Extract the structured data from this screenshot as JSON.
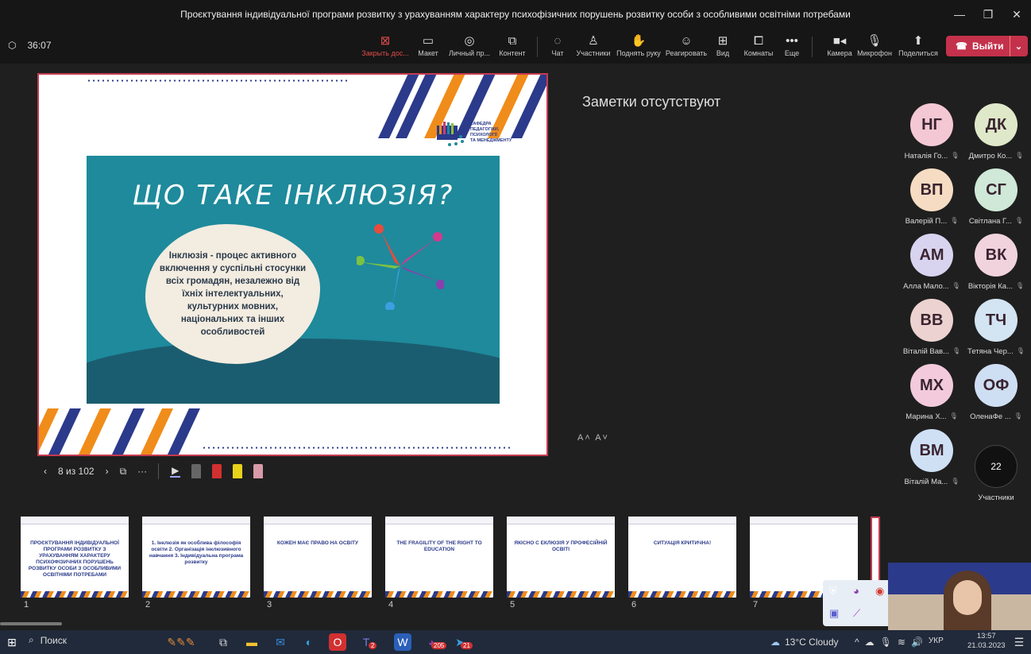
{
  "window": {
    "title": "Проєктування індивідуальної програми розвитку з урахуванням характеру психофізичних порушень розвитку особи з особливими освітніми потребами"
  },
  "meeting": {
    "timer": "36:07",
    "leave_label": "Выйти"
  },
  "toolbar": {
    "stop_share": "Закрыть дос...",
    "layout": "Макет",
    "personal": "Личный пр...",
    "content": "Контент",
    "chat": "Чат",
    "participants": "Участники",
    "raise_hand": "Поднять руку",
    "react": "Реагировать",
    "view": "Вид",
    "rooms": "Комнаты",
    "more": "Еще",
    "camera": "Камера",
    "mic": "Микрофон",
    "share": "Поделиться"
  },
  "slide": {
    "dept_line1": "КАФЕДРА",
    "dept_line2": "ПЕДАГОГІКИ,",
    "dept_line3": "ПСИХОЛОГІЇ",
    "dept_line4": "ТА МЕНЕДЖМЕНТУ",
    "heading": "ЩО ТАКЕ ІНКЛЮЗІЯ?",
    "definition": "Інклюзія - процес активного включення у суспільні стосунки всіх громадян, незалежно від їхніх інтелектуальних, культурних мовних, національних та інших особливостей"
  },
  "notes": {
    "empty_text": "Заметки отсутствуют",
    "font_controls": "A˄ A˅"
  },
  "slide_nav": {
    "counter": "8 из 102"
  },
  "participants": [
    {
      "initials": "НГ",
      "name": "Наталія Го...",
      "color": "#f4c7d4"
    },
    {
      "initials": "ДК",
      "name": "Дмитро Ко...",
      "color": "#dfe8c9"
    },
    {
      "initials": "ВП",
      "name": "Валерій П...",
      "color": "#f6dcc3"
    },
    {
      "initials": "СГ",
      "name": "Світлана Г...",
      "color": "#cfe8d8"
    },
    {
      "initials": "АМ",
      "name": "Алла Мало...",
      "color": "#d8d3ee"
    },
    {
      "initials": "ВК",
      "name": "Вікторія Ка...",
      "color": "#f1d3de"
    },
    {
      "initials": "ВВ",
      "name": "Віталій Вав...",
      "color": "#ecd2d0"
    },
    {
      "initials": "ТЧ",
      "name": "Тетяна Чер...",
      "color": "#d3e4f3"
    },
    {
      "initials": "МХ",
      "name": "Марина Х...",
      "color": "#f2cadb"
    },
    {
      "initials": "ОФ",
      "name": "ОленаФе ...",
      "color": "#cfdff3"
    },
    {
      "initials": "ВМ",
      "name": "Віталій Ма...",
      "color": "#cfe0f5"
    }
  ],
  "participants_more": {
    "count": "22",
    "label": "Участники"
  },
  "thumbnails": [
    {
      "num": "1",
      "text": "ПРОЄКТУВАННЯ ІНДИВІДУАЛЬНОЇ ПРОГРАМИ РОЗВИТКУ З УРАХУВАННЯМ ХАРАКТЕРУ ПСИХОФІЗИЧНИХ ПОРУШЕНЬ РОЗВИТКУ ОСОБИ З ОСОБЛИВИМИ ОСВІТНІМИ ПОТРЕБАМИ"
    },
    {
      "num": "2",
      "text": "1. Інклюзія як особлива філософія освіти 2. Організація інклюзивного навчання 3. Індивідуальна програма розвитку"
    },
    {
      "num": "3",
      "text": "КОЖЕН МАЄ ПРАВО НА ОСВІТУ"
    },
    {
      "num": "4",
      "text": "THE FRAGILITY OF THE RIGHT TO EDUCATION"
    },
    {
      "num": "5",
      "text": "ЯКІСНО С ЕКЛЮЗІЯ У ПРОФЕСІЙНІЙ ОСВІТІ"
    },
    {
      "num": "6",
      "text": "СИТУАЦІЯ КРИТИЧНА!"
    },
    {
      "num": "7",
      "text": ""
    }
  ],
  "taskbar": {
    "search": "Поиск",
    "weather": "13°C  Cloudy",
    "lang": "УКР",
    "time": "13:57",
    "date": "21.03.2023",
    "badge_teams": "2",
    "badge_viber": "205",
    "badge_tg": "21"
  }
}
